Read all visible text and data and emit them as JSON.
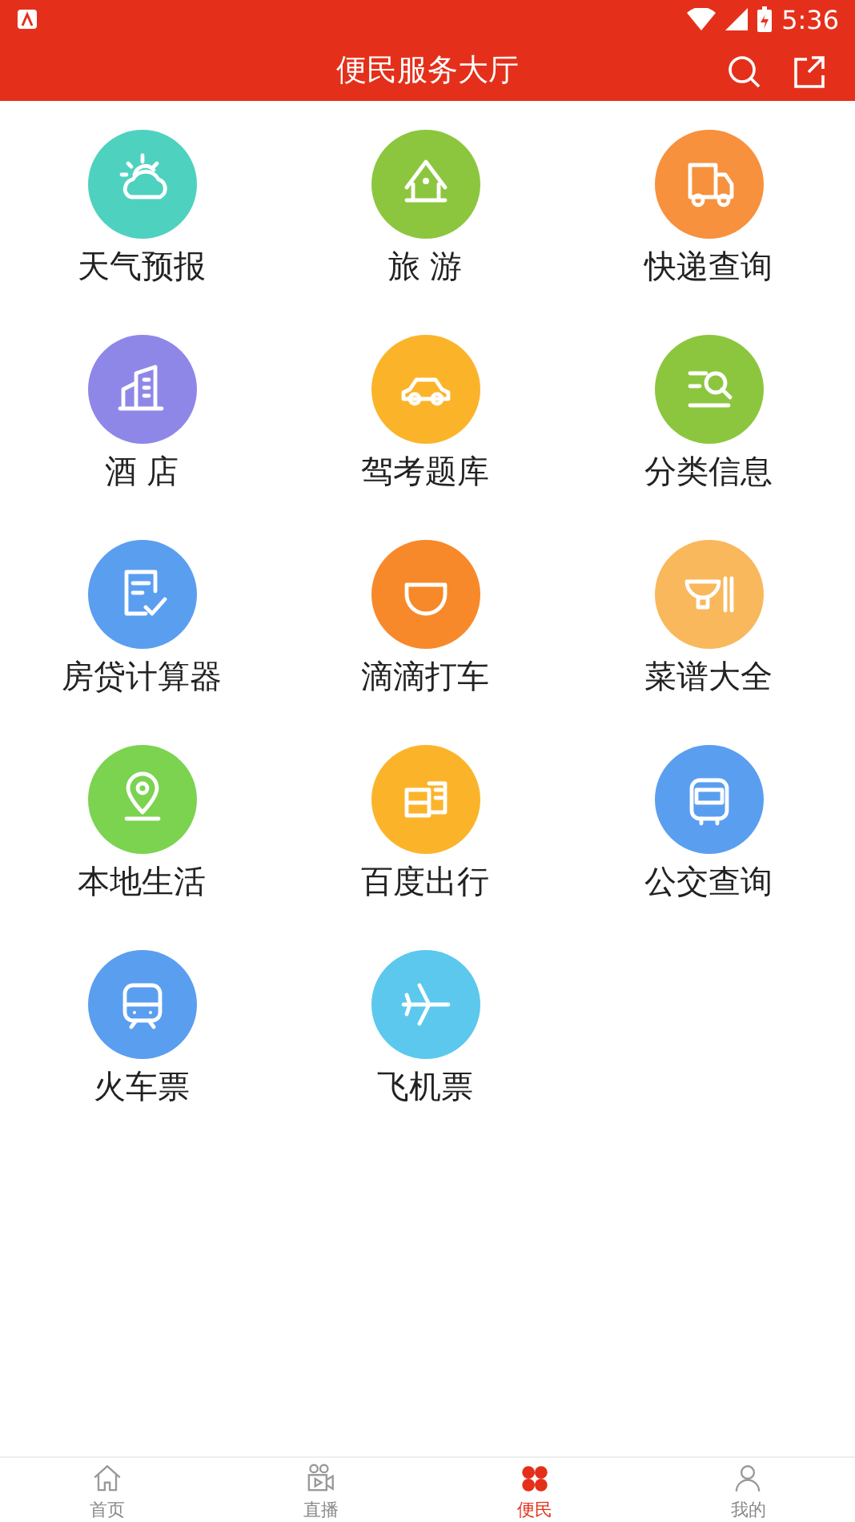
{
  "status_bar": {
    "time": "5:36"
  },
  "header": {
    "title": "便民服务大厅"
  },
  "services": [
    {
      "label": "天气预报",
      "kind": "weather",
      "color": "#4fd1c0"
    },
    {
      "label": "旅 游",
      "kind": "travel",
      "color": "#8cc63f"
    },
    {
      "label": "快递查询",
      "kind": "delivery",
      "color": "#f7913d"
    },
    {
      "label": "酒 店",
      "kind": "hotel",
      "color": "#8f87e8"
    },
    {
      "label": "驾考题库",
      "kind": "driving",
      "color": "#fbb42a"
    },
    {
      "label": "分类信息",
      "kind": "classifieds",
      "color": "#8cc63f"
    },
    {
      "label": "房贷计算器",
      "kind": "loan",
      "color": "#5a9ef0"
    },
    {
      "label": "滴滴打车",
      "kind": "taxi",
      "color": "#f7892b"
    },
    {
      "label": "菜谱大全",
      "kind": "recipe",
      "color": "#f9b85c"
    },
    {
      "label": "本地生活",
      "kind": "local",
      "color": "#7bd350"
    },
    {
      "label": "百度出行",
      "kind": "trip",
      "color": "#fbb42a"
    },
    {
      "label": "公交查询",
      "kind": "bus",
      "color": "#5a9ef0"
    },
    {
      "label": "火车票",
      "kind": "train",
      "color": "#5a9ef0"
    },
    {
      "label": "飞机票",
      "kind": "flight",
      "color": "#5cc8ee"
    }
  ],
  "tabs": [
    {
      "label": "首页",
      "kind": "home",
      "selected": false
    },
    {
      "label": "直播",
      "kind": "live",
      "selected": false
    },
    {
      "label": "便民",
      "kind": "services",
      "selected": true
    },
    {
      "label": "我的",
      "kind": "me",
      "selected": false
    }
  ]
}
